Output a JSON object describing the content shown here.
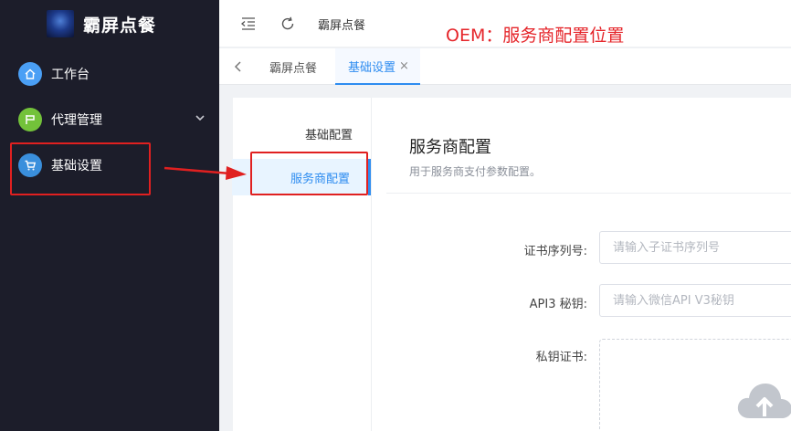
{
  "brand": {
    "title": "霸屏点餐"
  },
  "sidebar": {
    "items": [
      {
        "label": "工作台",
        "icon": "home-icon",
        "color": "#4a9ff5"
      },
      {
        "label": "代理管理",
        "icon": "flag-icon",
        "color": "#73c23a"
      },
      {
        "label": "基础设置",
        "icon": "cart-icon",
        "color": "#3a8fdc"
      }
    ]
  },
  "header": {
    "breadcrumb": "霸屏点餐",
    "annotation": "OEM：服务商配置位置"
  },
  "tags": [
    {
      "label": "霸屏点餐",
      "active": false
    },
    {
      "label": "基础设置",
      "active": true,
      "close": "×"
    }
  ],
  "subnav": {
    "items": [
      {
        "label": "基础配置",
        "active": false
      },
      {
        "label": "服务商配置",
        "active": true
      }
    ]
  },
  "section": {
    "title": "服务商配置",
    "description": "用于服务商支付参数配置。"
  },
  "form": {
    "cert_serial": {
      "label": "证书序列号:",
      "placeholder": "请输入子证书序列号"
    },
    "api3_key": {
      "label": "API3 秘钥:",
      "placeholder": "请输入微信API V3秘钥"
    },
    "private_cert": {
      "label": "私钥证书:"
    }
  },
  "colors": {
    "sidebar_bg": "#1c1d2a",
    "accent": "#2d8cf0",
    "annotation_red": "#e02020"
  }
}
